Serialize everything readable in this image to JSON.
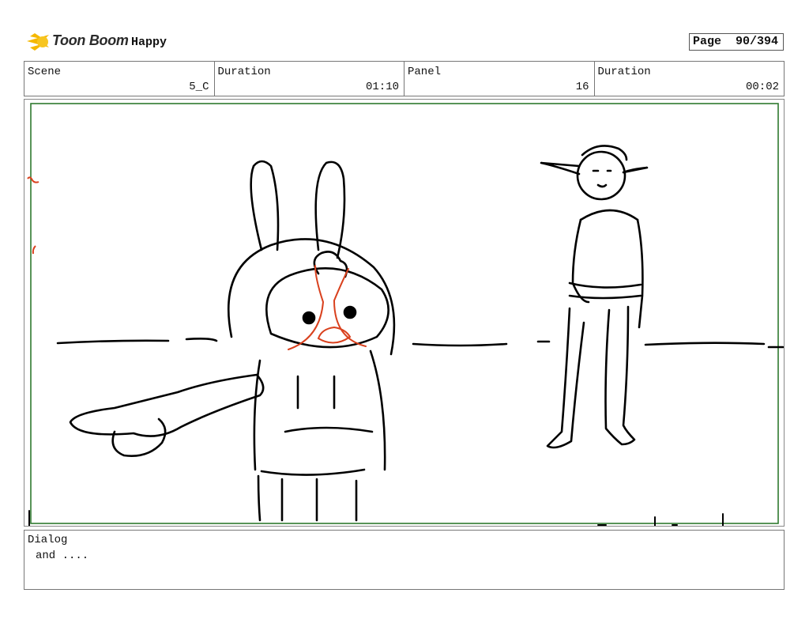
{
  "header": {
    "brand": "Toon Boom",
    "project_title": "Happy",
    "page_label": "Page",
    "page_value": "90/394"
  },
  "info": {
    "scene_label": "Scene",
    "scene_value": "5_C",
    "duration_label": "Duration",
    "duration_value": "01:10",
    "panel_label": "Panel",
    "panel_value": "16",
    "panel_duration_label": "Duration",
    "panel_duration_value": "00:02"
  },
  "dialog": {
    "label": "Dialog",
    "text": "and ...."
  },
  "colors": {
    "frame_green": "#2f7a2f",
    "sketch_red": "#d9411e",
    "logo_yellow": "#f5b800"
  }
}
